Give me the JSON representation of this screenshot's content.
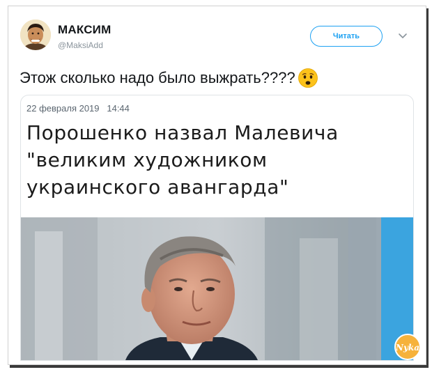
{
  "user": {
    "name": "МАКСИМ",
    "handle": "@MaksiAdd"
  },
  "follow_button": {
    "label": "Читать"
  },
  "tweet": {
    "text": "Этож сколько надо было выжрать????",
    "emoji": "worried-face-emoji"
  },
  "card": {
    "date": "22 февраля 2019   14:44",
    "headline_lines": [
      "Порошенко назвал Малевича",
      "\"великим художником",
      "украинского авангарда\""
    ],
    "photo": "man-portrait-photo"
  },
  "watermark": {
    "text": "Nyka"
  },
  "colors": {
    "accent": "#1da1f2",
    "text": "#14171a",
    "muted": "#8a949c",
    "frame_shadow": "#3a3a3a"
  }
}
